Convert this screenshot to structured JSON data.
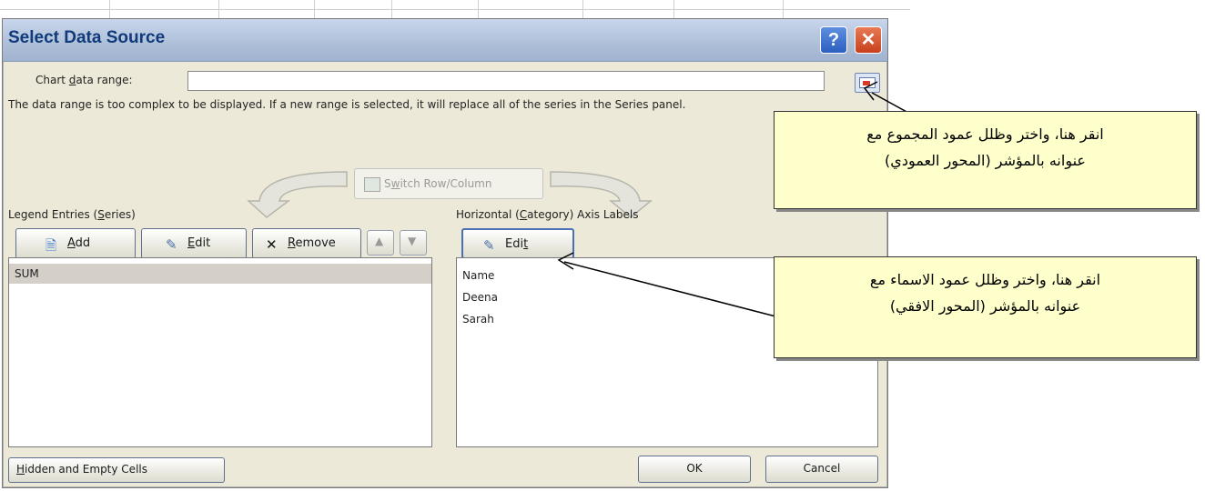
{
  "window": {
    "title": "Select Data Source",
    "help_glyph": "?",
    "close_glyph": "✕"
  },
  "chart_range": {
    "label_prefix": "Chart ",
    "label_access": "d",
    "label_suffix": "ata range:",
    "value": ""
  },
  "info_text": "The data range is too complex to be displayed. If a new range is selected, it will replace all of the series in the Series panel.",
  "switch_button": {
    "label_prefix": "S",
    "label_access": "w",
    "label_suffix": "itch Row/Column"
  },
  "legend": {
    "heading_prefix": "Legend Entries (",
    "heading_access": "S",
    "heading_suffix": "eries)",
    "add_access": "A",
    "add_rest": "dd",
    "edit_access": "E",
    "edit_rest": "dit",
    "remove_access": "R",
    "remove_rest": "emove",
    "items": [
      {
        "label": "SUM"
      }
    ]
  },
  "axis": {
    "heading_prefix": "Horizontal (",
    "heading_access": "C",
    "heading_suffix": "ategory) Axis Labels",
    "edit_prefix": "Edi",
    "edit_access": "t",
    "items": [
      {
        "label": "Name"
      },
      {
        "label": "Deena"
      },
      {
        "label": "Sarah"
      }
    ]
  },
  "footer": {
    "hidden_access": "H",
    "hidden_rest": "idden and Empty Cells",
    "ok_label": "OK",
    "cancel_label": "Cancel"
  },
  "callouts": [
    {
      "line1": "انقر هنا، واختر وظلل عمود المجموع مع",
      "line2": "عنوانه بالمؤشر (المحور العمودي)"
    },
    {
      "line1": "انقر هنا، واختر وظلل عمود الاسماء مع",
      "line2": "عنوانه بالمؤشر (المحور الافقي)"
    }
  ],
  "colors": {
    "dialog_bg": "#ece9d8",
    "title_text": "#103a7a",
    "callout_bg": "#ffffcc"
  }
}
